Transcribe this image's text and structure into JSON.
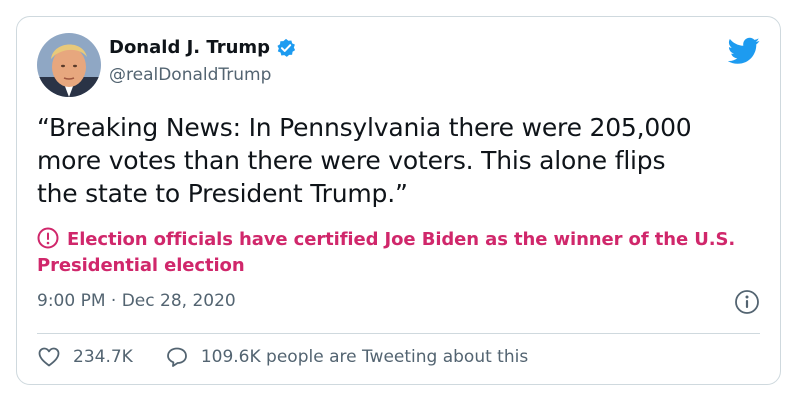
{
  "author": {
    "name": "Donald J. Trump",
    "handle": "@realDonaldTrump",
    "verified": true
  },
  "tweet": {
    "text": "“Breaking News: In Pennsylvania there were 205,000\nmore votes than there were voters. This alone flips\nthe state to President Trump.”",
    "timestamp": "9:00 PM · Dec 28, 2020"
  },
  "notice": {
    "text": "Election officials have certified Joe Biden as the winner of the U.S. Presidential election",
    "color": "#d0276b"
  },
  "actions": {
    "likes": "234.7K",
    "conversation": "109.6K people are Tweeting about this"
  },
  "icons": {
    "brand": "twitter-bird-icon",
    "verified": "verified-badge-icon",
    "notice": "exclamation-circle-icon",
    "info": "info-icon",
    "like": "heart-icon",
    "reply": "speech-bubble-icon"
  },
  "colors": {
    "brand_blue": "#1d9bf0",
    "secondary_text": "#536471",
    "border": "#cfd9de"
  }
}
